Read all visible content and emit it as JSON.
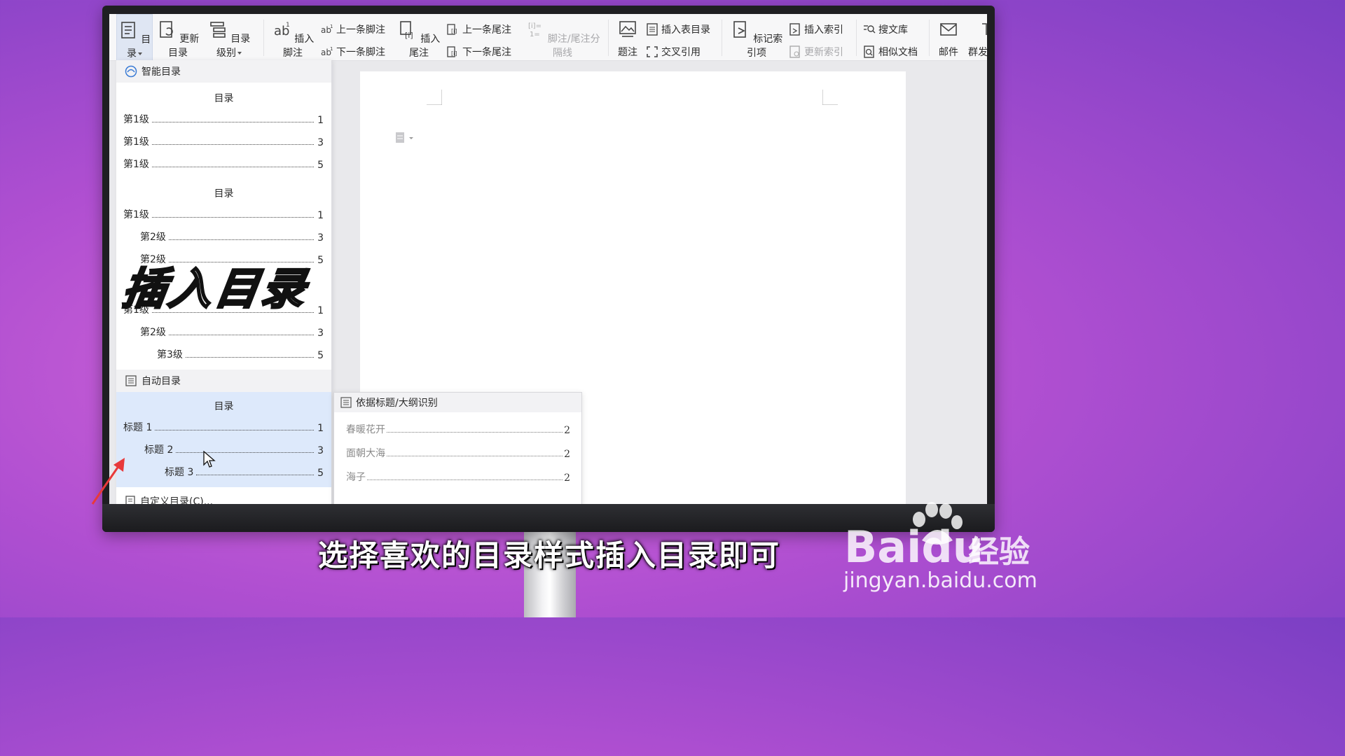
{
  "ribbon": {
    "toc": "目录",
    "update_toc": "更新目录",
    "toc_level": "目录级别",
    "insert_footnote": "插入脚注",
    "prev_footnote": "上一条脚注",
    "next_footnote": "下一条脚注",
    "insert_endnote": "插入尾注",
    "prev_endnote": "上一条尾注",
    "next_endnote": "下一条尾注",
    "separator": "脚注/尾注分隔线",
    "caption": "题注",
    "insert_table_toc": "插入表目录",
    "cross_ref": "交叉引用",
    "mark_index": "标记索引项",
    "insert_index": "插入索引",
    "update_index": "更新索引",
    "search_lib": "搜文库",
    "similar_docs": "相似文档",
    "mail": "邮件",
    "mass_send": "群发"
  },
  "smart": {
    "header": "智能目录",
    "block1": {
      "title": "目录",
      "lines": [
        {
          "label": "第1级",
          "page": "1"
        },
        {
          "label": "第1级",
          "page": "3"
        },
        {
          "label": "第1级",
          "page": "5"
        }
      ]
    },
    "block2": {
      "title": "目录",
      "lines": [
        {
          "label": "第1级",
          "page": "1"
        },
        {
          "label": "第2级",
          "page": "3"
        },
        {
          "label": "第2级",
          "page": "5"
        }
      ]
    },
    "block3": {
      "lines": [
        {
          "label": "第1级",
          "page": "1"
        },
        {
          "label": "第2级",
          "page": "3"
        },
        {
          "label": "第3级",
          "page": "5"
        }
      ]
    }
  },
  "auto": {
    "header": "自动目录",
    "title": "目录",
    "lines": [
      {
        "label": "标题 1",
        "page": "1"
      },
      {
        "label": "标题 2",
        "page": "3"
      },
      {
        "label": "标题 3",
        "page": "5"
      }
    ],
    "custom": "自定义目录(C)..."
  },
  "submenu": {
    "header": "依据标题/大纲识别",
    "lines": [
      {
        "label": "春暖花开",
        "page": "2"
      },
      {
        "label": "面朝大海",
        "page": "2"
      },
      {
        "label": "海子",
        "page": "2"
      }
    ]
  },
  "overlay_title": "插入目录",
  "caption": "选择喜欢的目录样式插入目录即可",
  "watermark": {
    "brand": "Bai",
    "brand2": "du",
    "cn": "经验",
    "url": "jingyan.baidu.com"
  },
  "colors": {
    "accent": "#dde9fb",
    "arrow": "#e8393a",
    "background": "#b04fd1"
  }
}
